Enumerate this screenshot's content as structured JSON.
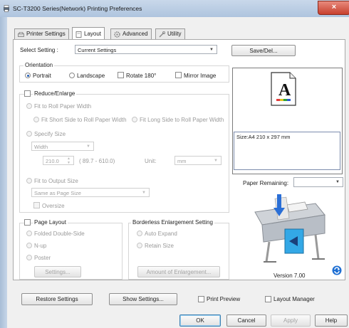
{
  "window": {
    "title": "SC-T3200 Series(Network) Printing Preferences",
    "close_label": "×"
  },
  "tabs": [
    {
      "label": "Printer Settings"
    },
    {
      "label": "Layout"
    },
    {
      "label": "Advanced"
    },
    {
      "label": "Utility"
    }
  ],
  "select_setting": {
    "label": "Select Setting :",
    "value": "Current Settings",
    "save_button": "Save/Del..."
  },
  "orientation": {
    "title": "Orientation",
    "portrait": "Portrait",
    "landscape": "Landscape",
    "rotate": "Rotate 180°",
    "mirror": "Mirror Image"
  },
  "reduce_enlarge": {
    "title": "Reduce/Enlarge",
    "fit_roll": "Fit to Roll Paper Width",
    "fit_short": "Fit Short Side to Roll Paper Width",
    "fit_long": "Fit Long Side to Roll Paper Width",
    "specify_size": "Specify Size",
    "width_combo": "Width",
    "size_value": "210.0",
    "size_range": "( 89.7 - 610.0)",
    "unit_label": "Unit:",
    "unit_value": "mm",
    "fit_output": "Fit to Output Size",
    "output_combo": "Same as Page Size",
    "oversize": "Oversize"
  },
  "page_layout": {
    "title": "Page Layout",
    "folded": "Folded Double-Side",
    "nup": "N-up",
    "poster": "Poster",
    "settings_button": "Settings..."
  },
  "borderless": {
    "title": "Borderless Enlargement Setting",
    "auto_expand": "Auto Expand",
    "retain_size": "Retain Size",
    "amount_button": "Amount of Enlargement..."
  },
  "preview": {
    "letter": "A",
    "size_text": "Size:A4 210 x 297 mm",
    "paper_remaining": "Paper Remaining:",
    "version": "Version 7.00"
  },
  "bottom": {
    "restore": "Restore Settings",
    "show": "Show Settings...",
    "print_preview": "Print Preview",
    "layout_manager": "Layout Manager"
  },
  "dialog_buttons": {
    "ok": "OK",
    "cancel": "Cancel",
    "apply": "Apply",
    "help": "Help"
  }
}
